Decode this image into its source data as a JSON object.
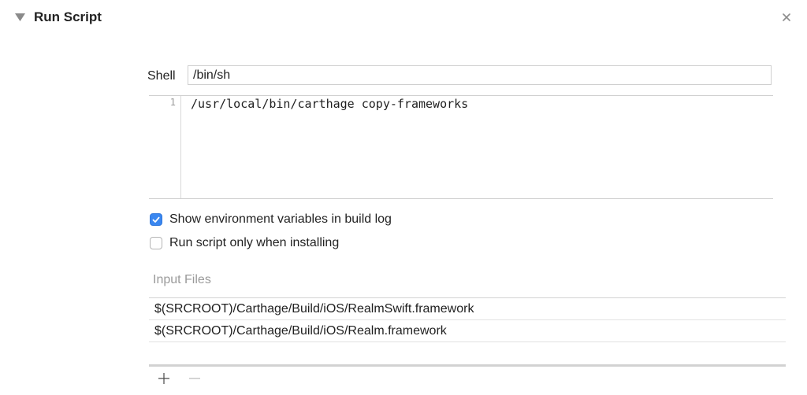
{
  "header": {
    "title": "Run Script",
    "disclosure_icon": "disclosure-triangle-down-icon",
    "close_icon": "close-icon"
  },
  "shell": {
    "label": "Shell",
    "value": "/bin/sh"
  },
  "script": {
    "lines": [
      {
        "number": "1",
        "code": "/usr/local/bin/carthage copy-frameworks"
      }
    ]
  },
  "options": {
    "show_env": {
      "label": "Show environment variables in build log",
      "checked": true
    },
    "install_only": {
      "label": "Run script only when installing",
      "checked": false
    }
  },
  "input_files": {
    "title": "Input Files",
    "items": [
      "$(SRCROOT)/Carthage/Build/iOS/RealmSwift.framework",
      "$(SRCROOT)/Carthage/Build/iOS/Realm.framework"
    ]
  },
  "toolbar": {
    "add_icon": "plus-icon",
    "remove_icon": "minus-icon"
  },
  "colors": {
    "accent": "#3a87f0",
    "muted_text": "#9a9a9a",
    "divider": "#d3d3d3"
  }
}
